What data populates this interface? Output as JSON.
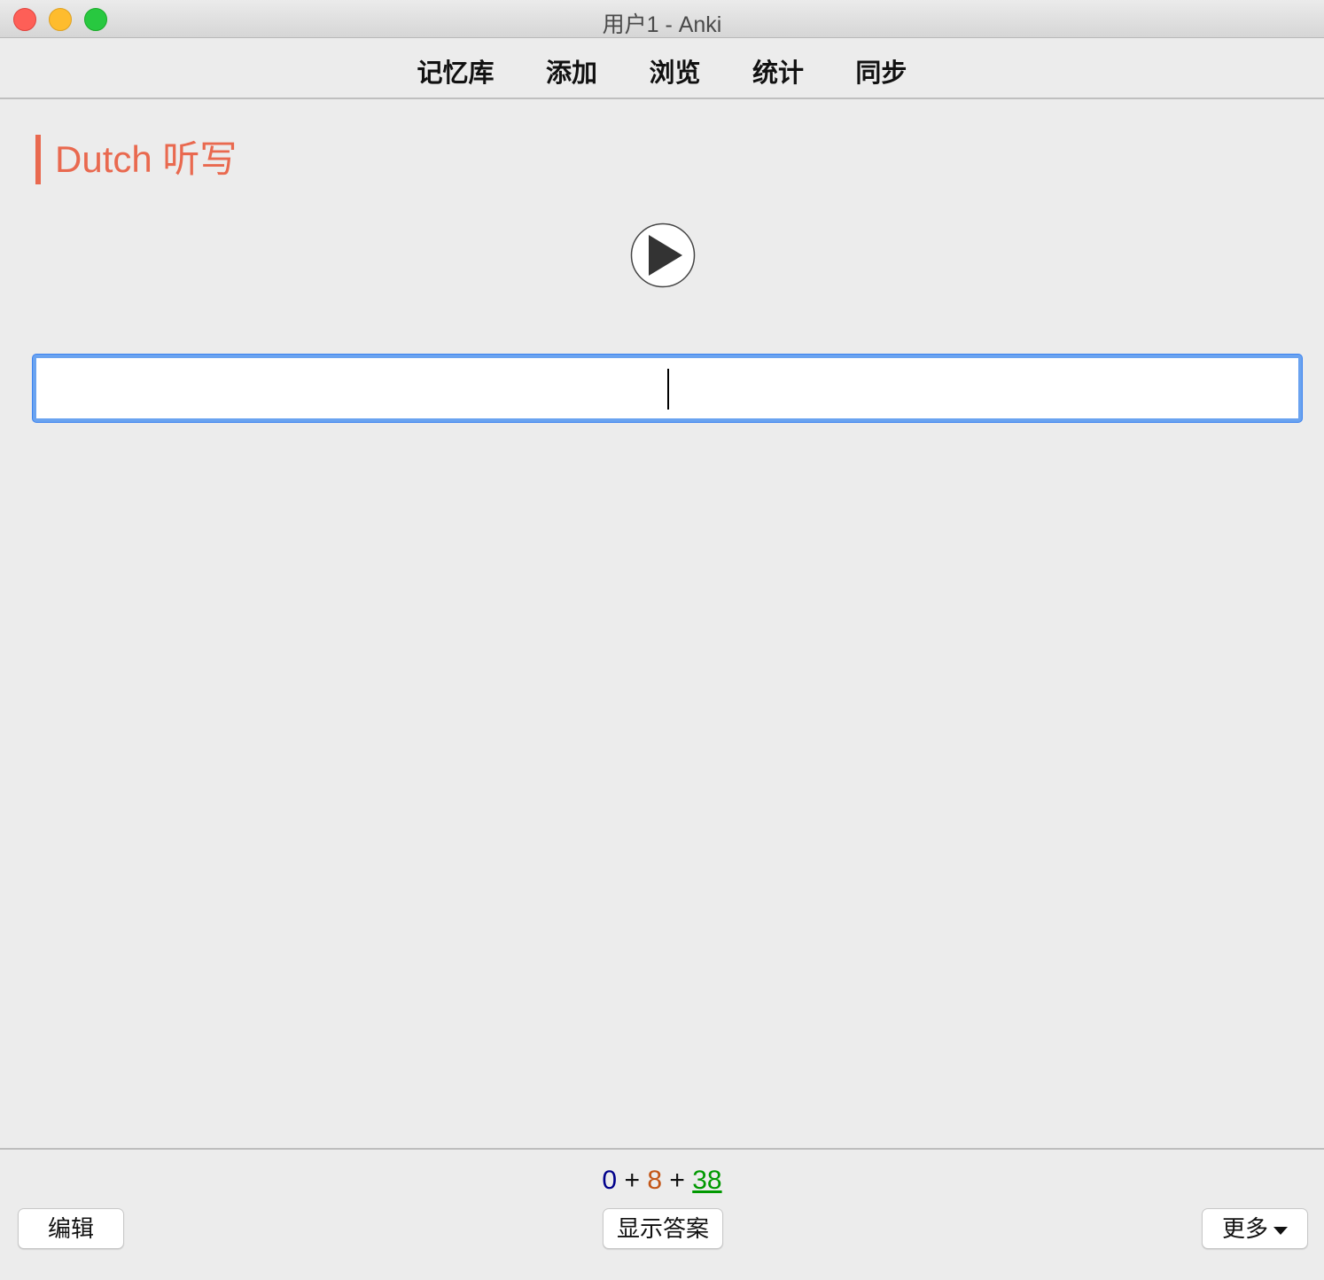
{
  "window": {
    "title": "用户1 - Anki"
  },
  "toolbar": {
    "items": [
      {
        "label": "记忆库"
      },
      {
        "label": "添加"
      },
      {
        "label": "浏览"
      },
      {
        "label": "统计"
      },
      {
        "label": "同步"
      }
    ]
  },
  "card": {
    "deck_title": "Dutch 听写",
    "answer_value": "",
    "accent_color": "#e9694f"
  },
  "bottom": {
    "counts": {
      "new": "0",
      "learning": "8",
      "review": "38",
      "separator": "+"
    },
    "edit_label": "编辑",
    "show_answer_label": "显示答案",
    "more_label": "更多"
  },
  "colors": {
    "new": "#00008b",
    "learning": "#c35617",
    "review": "#009900",
    "focus_ring": "#6aa3f0"
  }
}
